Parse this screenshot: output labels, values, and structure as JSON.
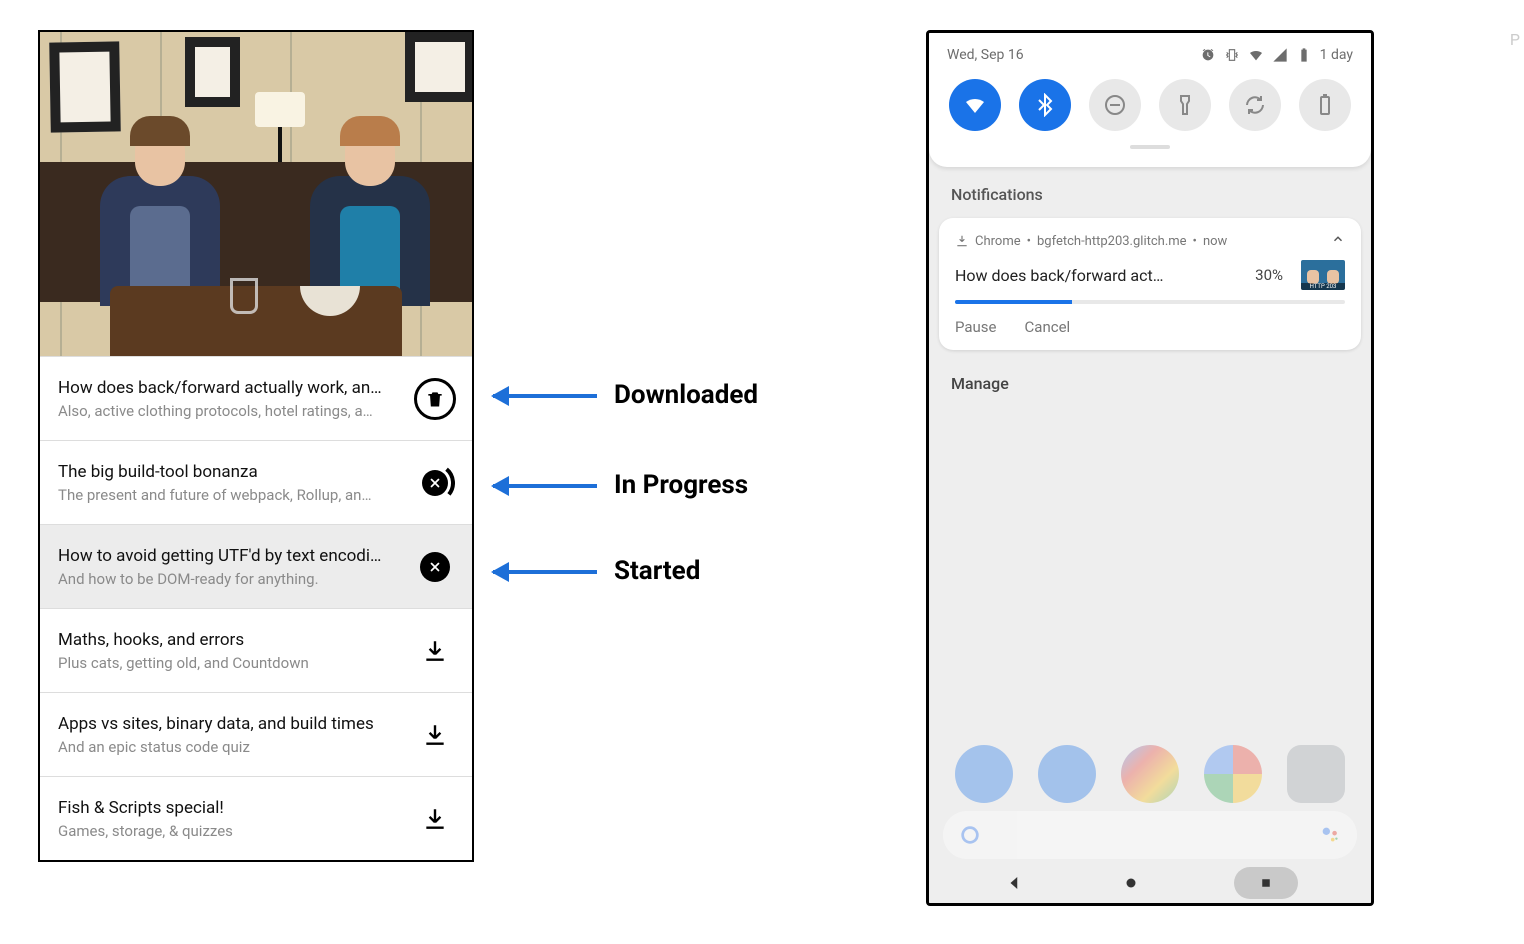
{
  "episodes": [
    {
      "title": "How does back/forward actually work, an…",
      "subtitle": "Also, active clothing protocols, hotel ratings, a…",
      "state": "downloaded"
    },
    {
      "title": "The big build-tool bonanza",
      "subtitle": "The present and future of webpack, Rollup, an…",
      "state": "in-progress"
    },
    {
      "title": "How to avoid getting UTF'd by text encodi…",
      "subtitle": "And how to be DOM-ready for anything.",
      "state": "started"
    },
    {
      "title": "Maths, hooks, and errors",
      "subtitle": "Plus cats, getting old, and Countdown",
      "state": "idle"
    },
    {
      "title": "Apps vs sites, binary data, and build times",
      "subtitle": "And an epic status code quiz",
      "state": "idle"
    },
    {
      "title": "Fish & Scripts special!",
      "subtitle": "Games, storage, & quizzes",
      "state": "idle"
    }
  ],
  "annotations": {
    "downloaded": "Downloaded",
    "in_progress": "In Progress",
    "started": "Started"
  },
  "phone": {
    "status": {
      "date": "Wed, Sep 16",
      "battery_text": "1 day"
    },
    "notifications_label": "Notifications",
    "manage_label": "Manage",
    "notification": {
      "app": "Chrome",
      "source": "bgfetch-http203.glitch.me",
      "time": "now",
      "title": "How does back/forward act…",
      "percent_text": "30%",
      "percent": 30,
      "actions": {
        "pause": "Pause",
        "cancel": "Cancel"
      }
    }
  }
}
